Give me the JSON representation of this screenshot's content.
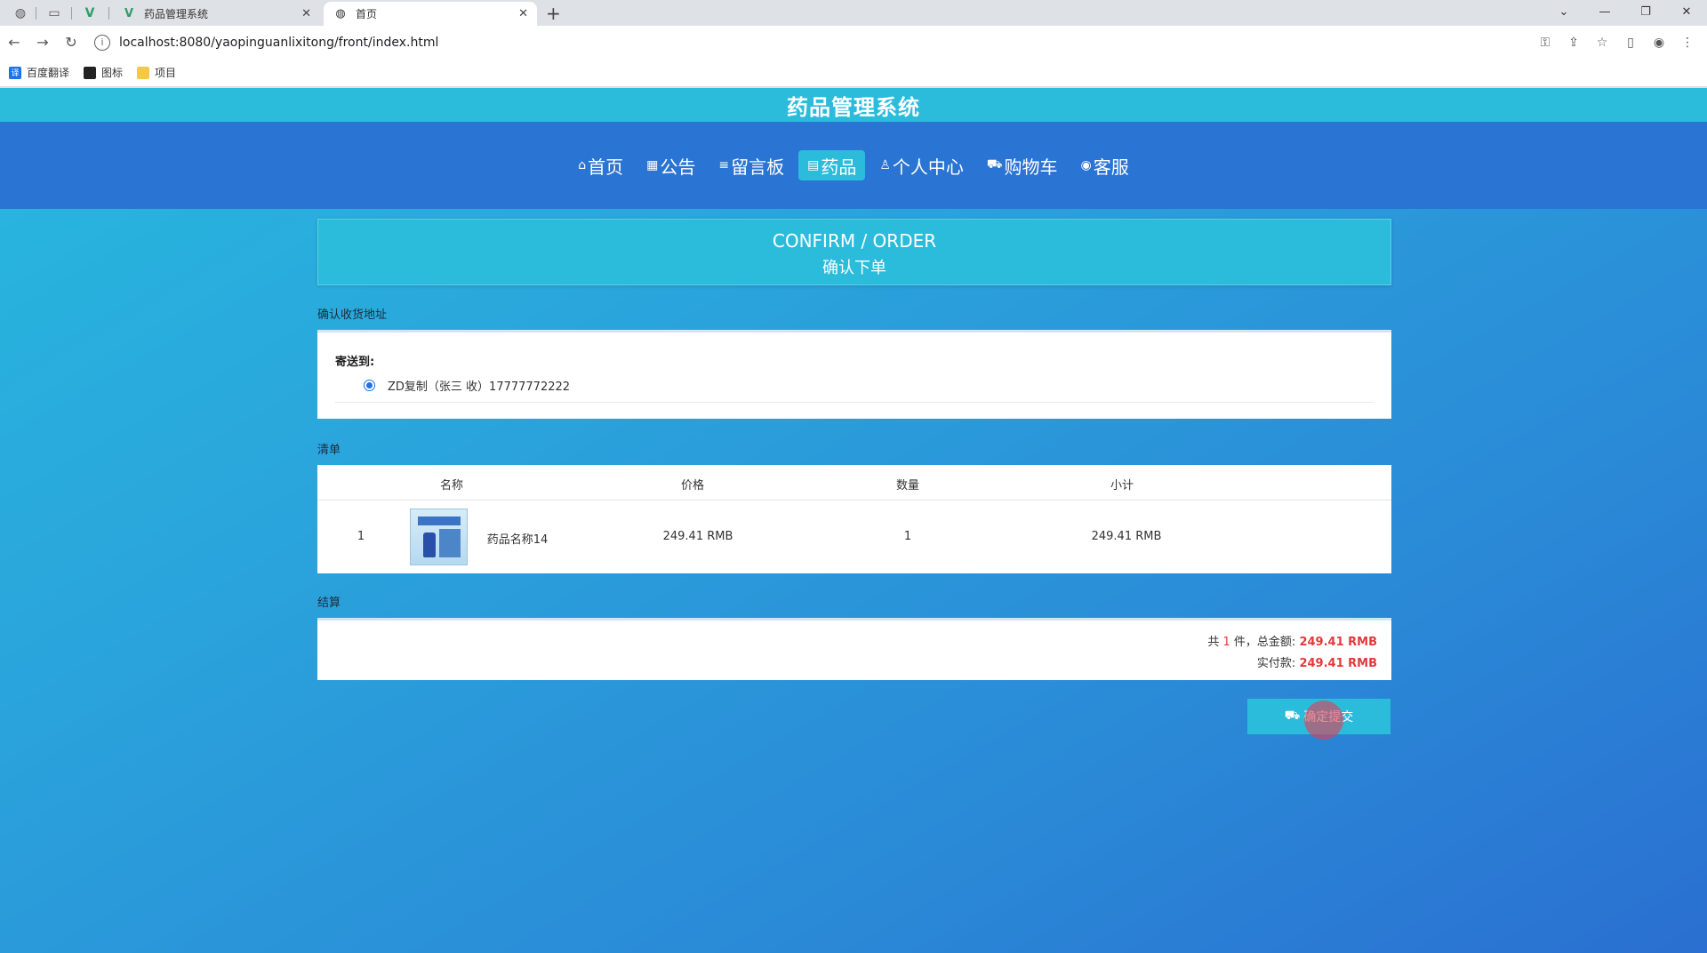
{
  "browser": {
    "tabs": [
      {
        "title": "药品管理系统",
        "active": false
      },
      {
        "title": "首页",
        "active": true
      }
    ],
    "url": "localhost:8080/yaopinguanlixitong/front/index.html",
    "bookmarks": [
      "百度翻译",
      "图标",
      "项目"
    ]
  },
  "site": {
    "title": "药品管理系统",
    "nav": [
      {
        "icon": "home-icon",
        "glyph": "⌂",
        "label": "首页",
        "active": false
      },
      {
        "icon": "notice-icon",
        "glyph": "▦",
        "label": "公告",
        "active": false
      },
      {
        "icon": "message-board-icon",
        "glyph": "≡",
        "label": "留言板",
        "active": false
      },
      {
        "icon": "medicine-icon",
        "glyph": "▤",
        "label": "药品",
        "active": true
      },
      {
        "icon": "user-icon",
        "glyph": "♙",
        "label": "个人中心",
        "active": false
      },
      {
        "icon": "cart-icon",
        "glyph": "⛟",
        "label": "购物车",
        "active": false
      },
      {
        "icon": "customer-service-icon",
        "glyph": "◉",
        "label": "客服",
        "active": false
      }
    ]
  },
  "order": {
    "heading_en": "CONFIRM / ORDER",
    "heading_zh": "确认下单",
    "address_section_label": "确认收货地址",
    "ship_to_label": "寄送到:",
    "address": "ZD复制（张三 收）17777772222",
    "list_section_label": "清单",
    "columns": [
      "名称",
      "价格",
      "数量",
      "小计"
    ],
    "items": [
      {
        "index": "1",
        "name": "药品名称14",
        "price": "249.41 RMB",
        "quantity": "1",
        "subtotal": "249.41 RMB"
      }
    ],
    "settle_section_label": "结算",
    "summary": {
      "count_prefix": "共",
      "count": "1",
      "count_suffix": "件，总金额:",
      "total": "249.41 RMB",
      "paid_label": "实付款:",
      "paid": "249.41 RMB"
    },
    "submit_label": "确定提交"
  }
}
